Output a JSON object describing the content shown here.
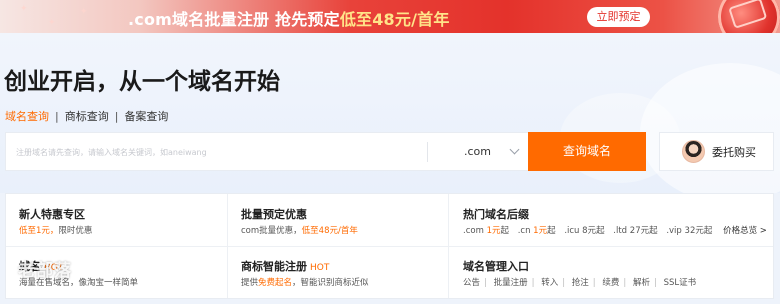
{
  "banner": {
    "text_prefix": ".com域名批量注册 抢先预定",
    "text_highlight": "低至48元/首年",
    "cta_label": "立即预定"
  },
  "hero": {
    "title": "创业开启，从一个域名开始",
    "tabs": [
      {
        "label": "域名查询",
        "active": true
      },
      {
        "label": "商标查询",
        "active": false
      },
      {
        "label": "备案查询",
        "active": false
      }
    ]
  },
  "search": {
    "placeholder": "注册域名请先查询，请输入域名关键词，如aneiwang",
    "suffix": ".com",
    "button_label": "查询域名",
    "consign_label": "委托购买"
  },
  "cards": {
    "newbie": {
      "title": "新人特惠专区",
      "desc_highlight": "低至1元，",
      "desc_rest": "限时优惠"
    },
    "batch": {
      "title": "批量预定优惠",
      "desc_prefix": "com批量优惠，",
      "desc_highlight": "低至48元/首年"
    },
    "hot_suffix": {
      "title": "热门域名后缀",
      "items": [
        {
          "name": ".com",
          "price": "1元",
          "unit": "起"
        },
        {
          "name": ".cn",
          "price": "1元",
          "unit": "起"
        },
        {
          "name": ".icu",
          "price": "8元",
          "unit": "起"
        },
        {
          "name": ".ltd",
          "price": "27元",
          "unit": "起"
        },
        {
          "name": ".vip",
          "price": "32元",
          "unit": "起"
        }
      ],
      "price_link": "价格总览 >"
    },
    "trade": {
      "title": "域名",
      "hot": "HOT",
      "desc": "海量在售域名，像淘宝一样简单"
    },
    "trademark": {
      "title": "商标智能注册",
      "hot": "HOT",
      "desc_prefix": "提供",
      "desc_highlight": "免费起名",
      "desc_rest": "，智能识别商标近似"
    },
    "manage": {
      "title": "域名管理入口",
      "links": [
        "公告",
        "批量注册",
        "转入",
        "抢注",
        "续费",
        "解析",
        "SSL证书"
      ]
    }
  },
  "watermark": "老部落",
  "colors": {
    "accent": "#ff6a00",
    "banner_red": "#e4322b"
  }
}
